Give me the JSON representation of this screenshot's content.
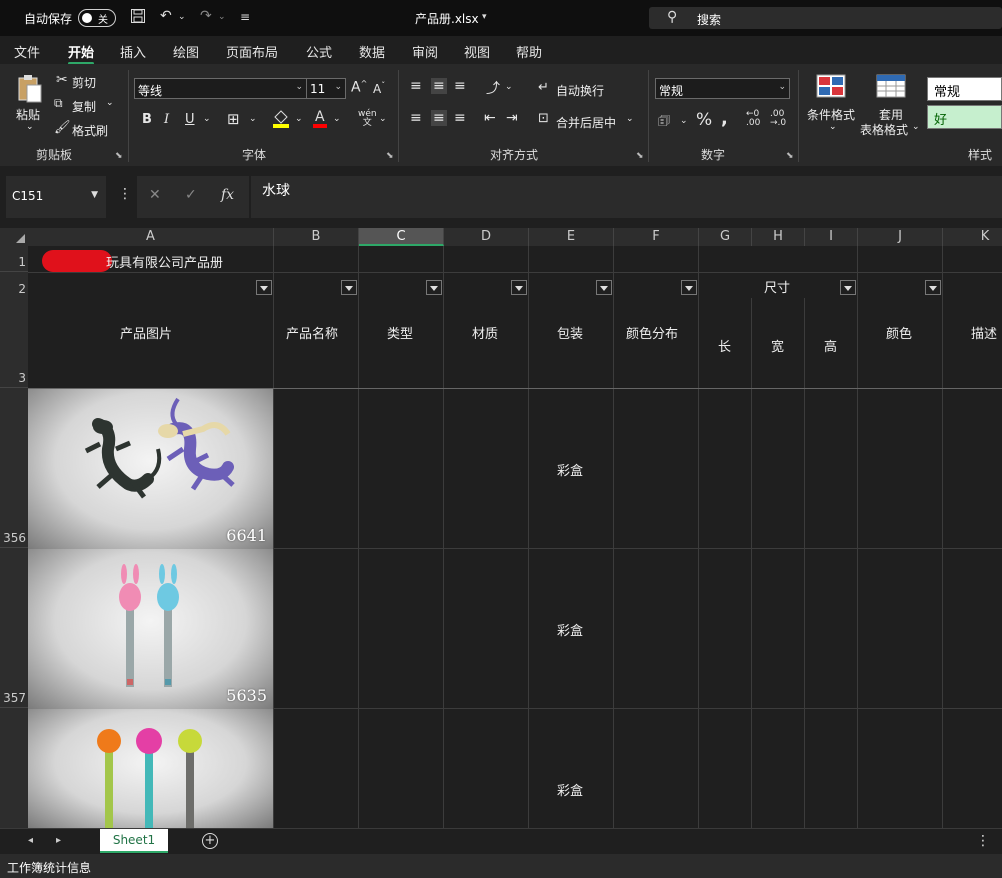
{
  "titlebar": {
    "autosave_label": "自动保存",
    "autosave_state": "关",
    "file_title": "产品册.xlsx",
    "search_label": "搜索"
  },
  "tabs": [
    "文件",
    "开始",
    "插入",
    "绘图",
    "页面布局",
    "公式",
    "数据",
    "审阅",
    "视图",
    "帮助"
  ],
  "active_tab": "开始",
  "ribbon": {
    "clipboard": {
      "paste": "粘贴",
      "cut": "剪切",
      "copy": "复制",
      "format_painter": "格式刷",
      "label": "剪贴板"
    },
    "font": {
      "name": "等线",
      "size": "11",
      "label": "字体",
      "phonetic": "wén\n文"
    },
    "alignment": {
      "wrap": "自动换行",
      "merge": "合并后居中",
      "label": "对齐方式"
    },
    "number": {
      "format": "常规",
      "label": "数字"
    },
    "styles": {
      "conditional": "条件格式",
      "table_format_1": "套用",
      "table_format_2": "表格格式",
      "normal": "常规",
      "good": "好",
      "label": "样式"
    }
  },
  "formula_bar": {
    "name_box": "C151",
    "formula": "水球"
  },
  "columns": [
    "A",
    "B",
    "C",
    "D",
    "E",
    "F",
    "G",
    "H",
    "I",
    "J",
    "K"
  ],
  "selected_column": "C",
  "rows": {
    "r1": "1",
    "r2": "2",
    "r3": "3",
    "r356": "356",
    "r357": "357"
  },
  "sheet": {
    "title_cell": "玩具有限公司产品册",
    "headers": {
      "a": "产品图片",
      "b": "产品名称",
      "c": "类型",
      "d": "材质",
      "e": "包装",
      "f": "颜色分布",
      "size": "尺寸",
      "g": "长",
      "h": "宽",
      "i": "高",
      "j": "颜色",
      "k": "描述"
    },
    "data_rows": [
      {
        "photo_code": "6641",
        "packaging": "彩盒"
      },
      {
        "photo_code": "5635",
        "packaging": "彩盒"
      },
      {
        "photo_code": "",
        "packaging": "彩盒"
      }
    ]
  },
  "sheet_tab": "Sheet1",
  "status_bar": "工作簿统计信息",
  "colors": {
    "accent": "#2ea868",
    "background": "#1f1f1f",
    "ribbon": "#292929",
    "good_fill": "#c6efce"
  }
}
